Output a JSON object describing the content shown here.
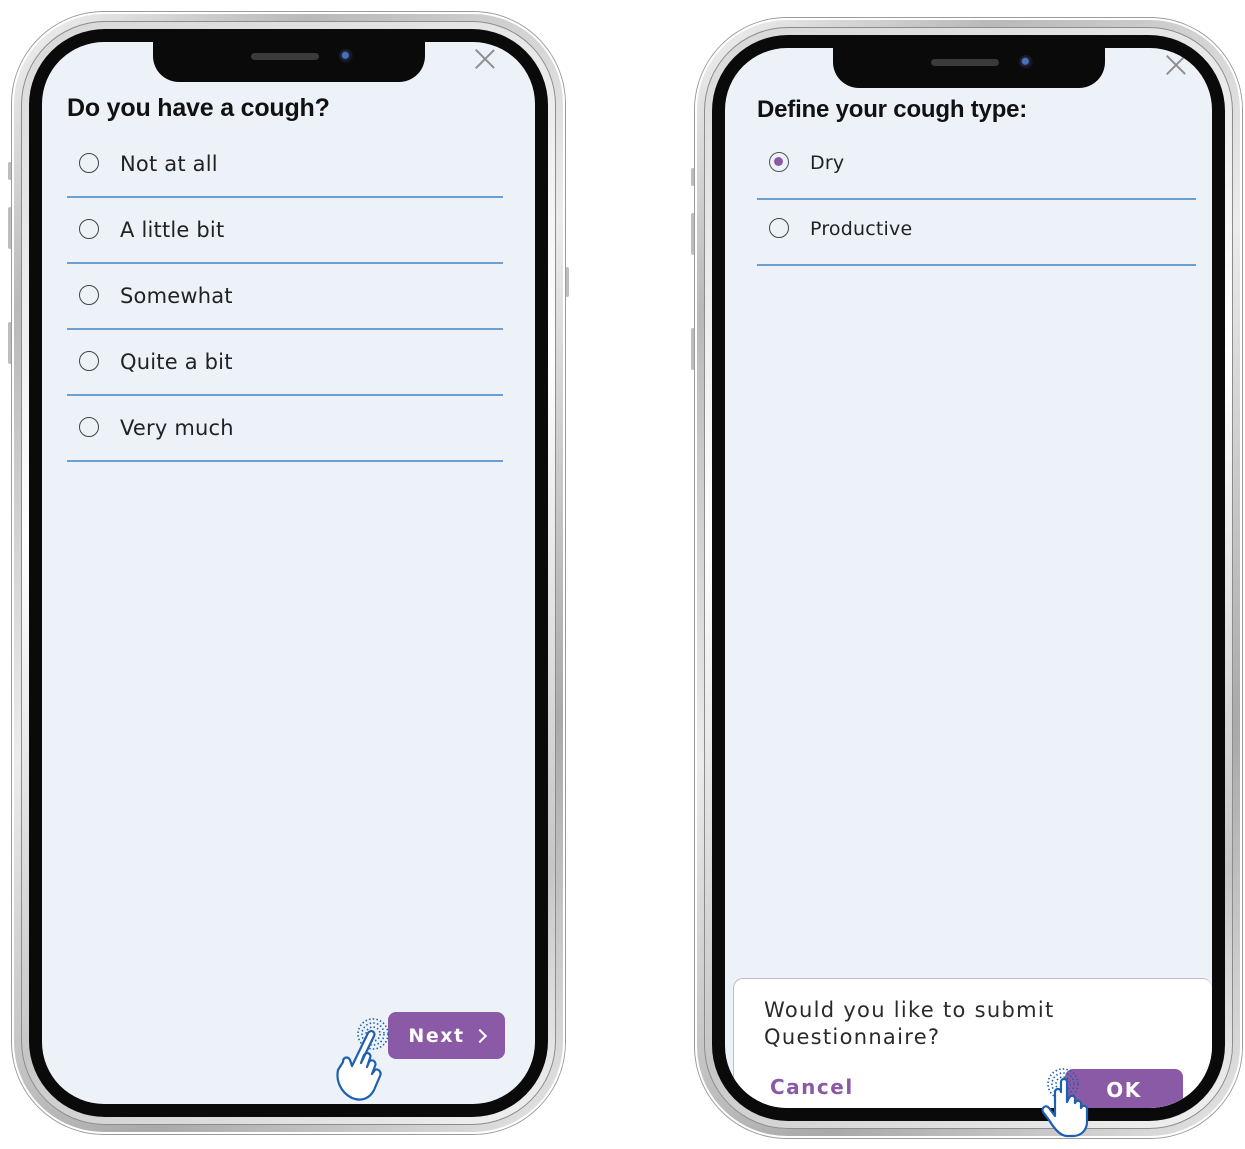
{
  "left_screen": {
    "question": "Do you have a cough?",
    "options": [
      {
        "label": "Not at all",
        "selected": false
      },
      {
        "label": "A little bit",
        "selected": false
      },
      {
        "label": "Somewhat",
        "selected": false
      },
      {
        "label": "Quite a bit",
        "selected": false
      },
      {
        "label": "Very much",
        "selected": false
      }
    ],
    "next_button": "Next"
  },
  "right_screen": {
    "question": "Define your cough type:",
    "options": [
      {
        "label": "Dry",
        "selected": true
      },
      {
        "label": "Productive",
        "selected": false
      }
    ],
    "dialog": {
      "message": "Would you like to submit Questionnaire?",
      "cancel_label": "Cancel",
      "ok_label": "OK"
    }
  },
  "colors": {
    "accent": "#8a5aa6",
    "divider": "#6a9fd3",
    "screen_bg": "#edf2f9",
    "hand_cursor": "#1f5fb0"
  },
  "icons": [
    "close-icon",
    "radio-icon",
    "chevron-right-icon",
    "hand-tap-cursor-icon"
  ]
}
